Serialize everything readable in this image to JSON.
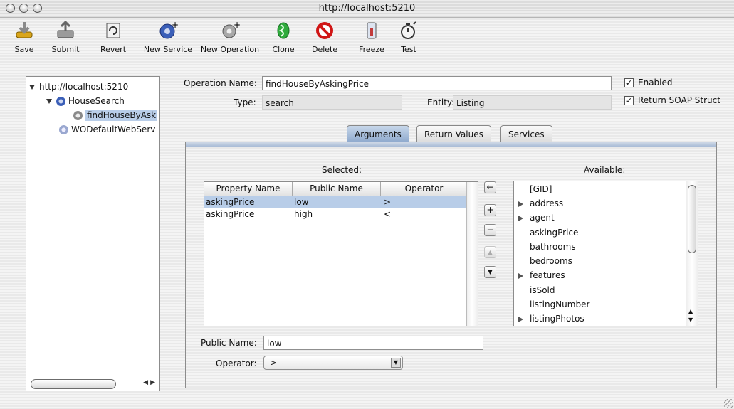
{
  "window": {
    "title": "http://localhost:5210"
  },
  "toolbar": {
    "items": [
      {
        "label": "Save",
        "icon": "save-icon"
      },
      {
        "label": "Submit",
        "icon": "submit-icon"
      },
      {
        "label": "Revert",
        "icon": "revert-icon"
      },
      {
        "label": "New Service",
        "icon": "new-service-icon"
      },
      {
        "label": "New Operation",
        "icon": "new-operation-icon"
      },
      {
        "label": "Clone",
        "icon": "clone-icon"
      },
      {
        "label": "Delete",
        "icon": "delete-icon"
      },
      {
        "label": "Freeze",
        "icon": "freeze-icon"
      },
      {
        "label": "Test",
        "icon": "test-icon"
      }
    ]
  },
  "tree": {
    "root": "http://localhost:5210",
    "service": "HouseSearch",
    "operation": "findHouseByAsk",
    "other_service": "WODefaultWebServ"
  },
  "form": {
    "operation_name_label": "Operation Name:",
    "operation_name_value": "findHouseByAskingPrice",
    "type_label": "Type:",
    "type_value": "search",
    "entity_label": "Entity:",
    "entity_value": "Listing",
    "enabled_label": "Enabled",
    "enabled_checked": true,
    "soap_label": "Return SOAP Struct",
    "soap_checked": true
  },
  "tabs": {
    "arguments": "Arguments",
    "return_values": "Return Values",
    "services": "Services",
    "selected": "Arguments"
  },
  "selected_section": {
    "title": "Selected:",
    "columns": [
      "Property Name",
      "Public Name",
      "Operator"
    ],
    "rows": [
      {
        "property": "askingPrice",
        "public": "low",
        "operator": ">"
      },
      {
        "property": "askingPrice",
        "public": "high",
        "operator": "<"
      }
    ]
  },
  "available_section": {
    "title": "Available:",
    "items": [
      {
        "name": "[GID]",
        "expandable": false
      },
      {
        "name": "address",
        "expandable": true
      },
      {
        "name": "agent",
        "expandable": true
      },
      {
        "name": "askingPrice",
        "expandable": false
      },
      {
        "name": "bathrooms",
        "expandable": false
      },
      {
        "name": "bedrooms",
        "expandable": false
      },
      {
        "name": "features",
        "expandable": true
      },
      {
        "name": "isSold",
        "expandable": false
      },
      {
        "name": "listingNumber",
        "expandable": false
      },
      {
        "name": "listingPhotos",
        "expandable": true
      }
    ]
  },
  "mid_buttons": {
    "add_left": "←",
    "plus": "+",
    "minus": "−",
    "up": "▲",
    "down": "▼"
  },
  "detail": {
    "public_name_label": "Public Name:",
    "public_name_value": "low",
    "operator_label": "Operator:",
    "operator_value": ">"
  },
  "colors": {
    "selection": "#b8cde8",
    "tab_selected": "#8ea9cd"
  }
}
